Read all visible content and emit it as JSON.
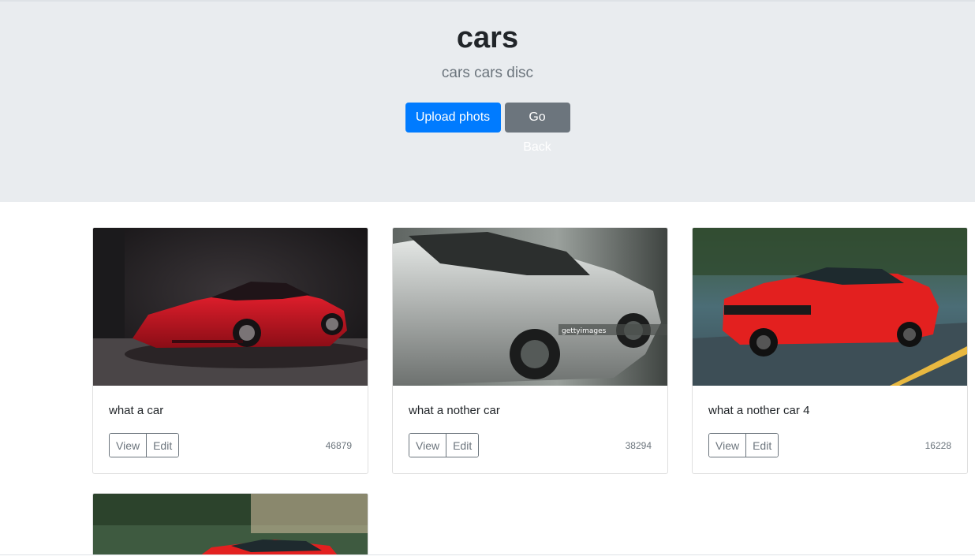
{
  "jumbotron": {
    "title": "cars",
    "lead": "cars cars disc",
    "upload_label": "Upload phots",
    "back_label": "Go Back"
  },
  "cards": [
    {
      "title": "what a car",
      "view": "View",
      "edit": "Edit",
      "count": "46879",
      "image": "red-sports-car-photo"
    },
    {
      "title": "what a nother car",
      "view": "View",
      "edit": "Edit",
      "count": "38294",
      "image": "silver-concept-car-photo"
    },
    {
      "title": "what a nother car 4",
      "view": "View",
      "edit": "Edit",
      "count": "16228",
      "image": "red-mustang-photo"
    },
    {
      "image": "red-mustang-photo"
    }
  ],
  "colors": {
    "primary": "#007bff",
    "secondary": "#6c757d",
    "jumbotron_bg": "#e9ecef"
  }
}
